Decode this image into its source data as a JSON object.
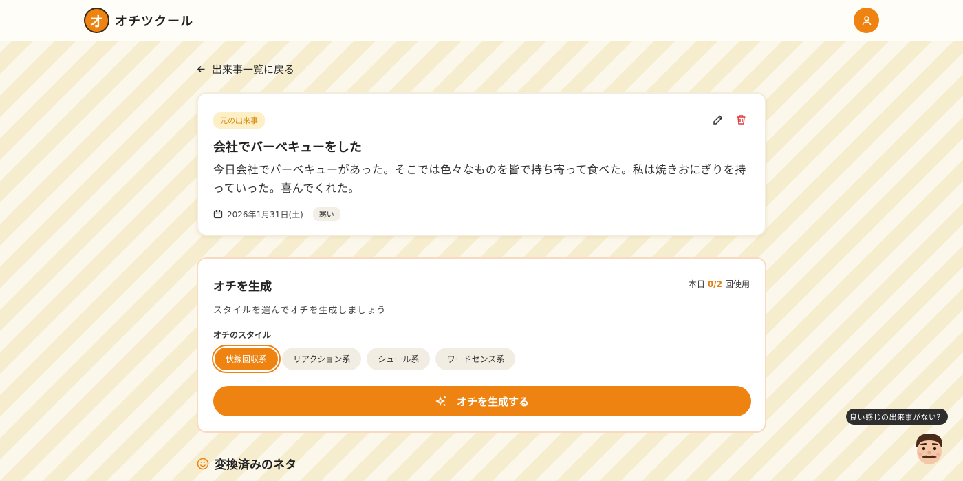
{
  "header": {
    "logo_mark": "オ",
    "app_name": "オチツクール"
  },
  "nav": {
    "back_label": "出来事一覧に戻る"
  },
  "event": {
    "badge": "元の出来事",
    "title": "会社でバーベキューをした",
    "body": "今日会社でバーベキューがあった。そこでは色々なものを皆で持ち寄って食べた。私は焼きおにぎりを持っていった。喜んでくれた。",
    "date": "2026年1月31日(土)",
    "weather_tag": "寒い"
  },
  "generator": {
    "title": "オチを生成",
    "usage_prefix": "本日",
    "usage_count": "0/2",
    "usage_suffix": "回使用",
    "subtitle": "スタイルを選んでオチを生成しましょう",
    "style_label": "オチのスタイル",
    "styles": [
      {
        "label": "伏線回収系",
        "selected": true
      },
      {
        "label": "リアクション系",
        "selected": false
      },
      {
        "label": "シュール系",
        "selected": false
      },
      {
        "label": "ワードセンス系",
        "selected": false
      }
    ],
    "button_label": "オチを生成する"
  },
  "converted": {
    "title": "変換済みのネタ"
  },
  "helper": {
    "bubble_text": "良い感じの出来事がない？"
  },
  "colors": {
    "accent": "#ee8311",
    "danger": "#e03a3a",
    "badge_bg": "#fdefc6",
    "badge_text": "#d98a10"
  },
  "icons": {
    "back": "arrow-left-icon",
    "edit": "pencil-icon",
    "delete": "trash-icon",
    "date": "calendar-icon",
    "generate": "sparkles-icon",
    "converted": "smile-icon",
    "user": "user-icon"
  }
}
